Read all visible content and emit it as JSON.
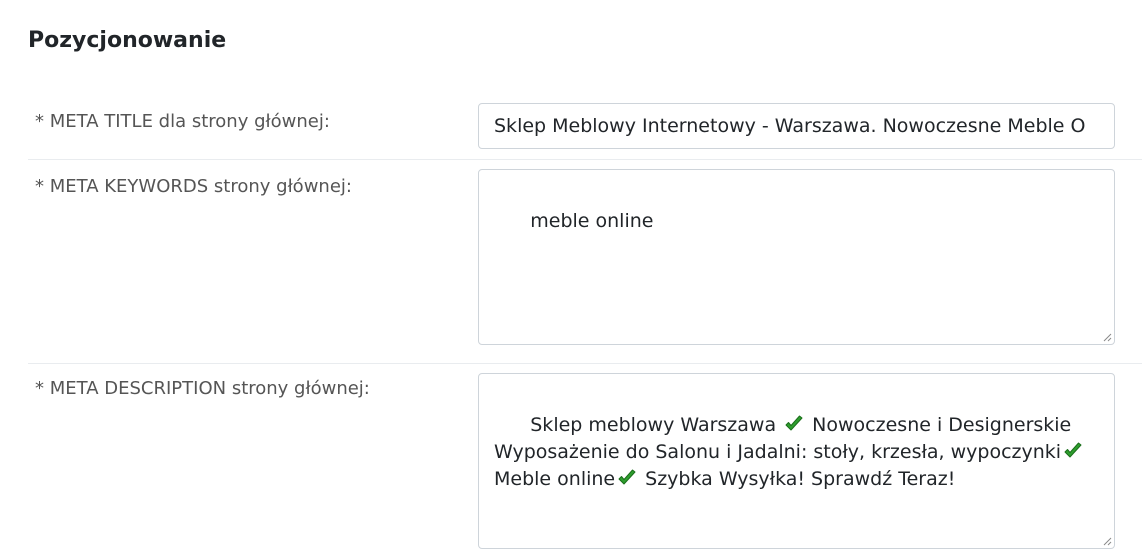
{
  "section": {
    "title": "Pozycjonowanie"
  },
  "fields": {
    "meta_title": {
      "label": "* META TITLE dla strony głównej:",
      "value": "Sklep Meblowy Internetowy - Warszawa. Nowoczesne Meble O"
    },
    "meta_keywords": {
      "label": "* META KEYWORDS strony głównej:",
      "value": "meble online"
    },
    "meta_description": {
      "label": "* META DESCRIPTION strony głównej:",
      "value": "Sklep meblowy Warszawa ✔️ Nowoczesne i Designerskie Wyposażenie do Salonu i Jadalni: stoły, krzesła, wypoczynki✔️ Meble online✔️ Szybka Wysyłka! Sprawdź Teraz!"
    }
  },
  "icons": {
    "check": "check-mark-icon",
    "check_color": "#2e9e2e",
    "resize": "resize-grip-icon"
  }
}
